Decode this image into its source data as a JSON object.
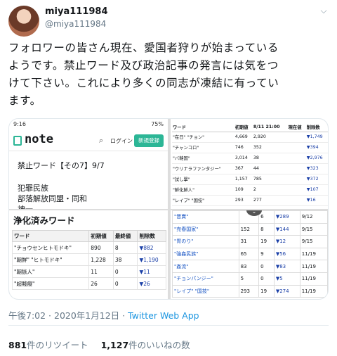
{
  "user": {
    "name": "miya111984",
    "handle": "@miya111984"
  },
  "tweet": {
    "lines": [
      "フォロワーの皆さん現在、愛国者狩りが始まっている",
      "ようです。禁止ワード及び政治記事の発言には気をつ",
      "けて下さい。これにより多くの同志が凍結に有ってい",
      "ます。"
    ],
    "timestamp": "午後7:02 · 2020年1月12日 ·",
    "source": "Twitter Web App",
    "retweets": "881",
    "retweets_label": "件のリツイート",
    "likes": "1,127",
    "likes_label": "件のいいねの数"
  },
  "media": {
    "phone": {
      "time": "9:16",
      "status_right": "75%",
      "logo": "note",
      "login": "ログイン",
      "register": "新規登録",
      "title": "禁止ワード【その7】9/7",
      "line1": "犯罪民族",
      "line2": "部落解放同盟・同和",
      "line3": "神一"
    },
    "table_top_right": {
      "headers": [
        "ワード",
        "初期値",
        "8/11 21:00",
        "現在値",
        "削除数"
      ],
      "rows": [
        [
          "\"在日\" \"チョン\"",
          "4,669",
          "2,920",
          "",
          "▼1,749"
        ],
        [
          "\"チャンコロ\"",
          "746",
          "352",
          "",
          "▼394"
        ],
        [
          "\"バ韓国\"",
          "3,014",
          "38",
          "",
          "▼2,976"
        ],
        [
          "\"ウリナラファンタジー\"",
          "367",
          "44",
          "",
          "▼323"
        ],
        [
          "\"試し撃\"",
          "1,157",
          "785",
          "",
          "▼372"
        ],
        [
          "\"鮮化鮮人\"",
          "109",
          "2",
          "",
          "▼107"
        ],
        [
          "\"レイプ\" \"国技\"",
          "293",
          "277",
          "",
          "▼16"
        ]
      ]
    },
    "table_bottom_left": {
      "heading": "浄化済みワード",
      "headers": [
        "ワード",
        "初期値",
        "最終値",
        "削除数"
      ],
      "rows": [
        [
          "\"チョウセンヒトモドキ\"",
          "890",
          "8",
          "▼882"
        ],
        [
          "\"朝鮮\" \"ヒトモドキ\"",
          "1,228",
          "38",
          "▼1,190"
        ],
        [
          "\"朝獄人\"",
          "11",
          "0",
          "▼11"
        ],
        [
          "\"超賤癡\"",
          "26",
          "0",
          "▼26"
        ]
      ]
    },
    "table_bottom_right": {
      "rows": [
        [
          "\"晋賣\"",
          "",
          "6",
          "▼289",
          "9/12"
        ],
        [
          "\"売春国家\"",
          "152",
          "8",
          "▼144",
          "9/15"
        ],
        [
          "\"胃のり\"",
          "31",
          "19",
          "▼12",
          "9/15"
        ],
        [
          "\"強姦民族\"",
          "65",
          "9",
          "▼56",
          "11/19"
        ],
        [
          "\"姦流\"",
          "83",
          "0",
          "▼83",
          "11/19"
        ],
        [
          "\"チョンパンジー\"",
          "5",
          "0",
          "▼5",
          "11/19"
        ],
        [
          "\"レイプ\" \"国技\"",
          "293",
          "19",
          "▼274",
          "11/19"
        ]
      ]
    }
  }
}
